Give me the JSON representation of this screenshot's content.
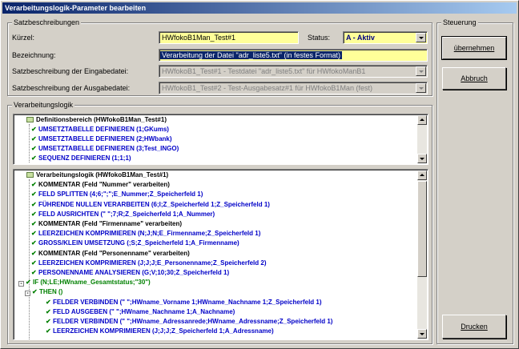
{
  "window": {
    "title": "Verarbeitungslogik-Parameter bearbeiten"
  },
  "satz": {
    "legend": "Satzbeschreibungen",
    "kuerzel_label": "Kürzel:",
    "kuerzel_value": "HWfokoB1Man_Test#1",
    "status_label": "Status:",
    "status_value": "A - Aktiv",
    "bezeichnung_label": "Bezeichnung:",
    "bezeichnung_value": "Verarbeitung der Datei \"adr_liste5.txt\" (in festes Format)",
    "eingabe_label": "Satzbeschreibung der Eingabedatei:",
    "eingabe_value": "HWfokoB1_Test#1 - Testdatei \"adr_liste5.txt\" für HWfokoManB1",
    "ausgabe_label": "Satzbeschreibung der Ausgabedatei:",
    "ausgabe_value": "HWfokoB1_Test#2 - Test-Ausgabesatz#1 für HWfokoB1Man (fest)"
  },
  "steuerung": {
    "legend": "Steuerung",
    "uebernehmen_label": "übernehmen",
    "abbruch_label": "Abbruch",
    "drucken_label": "Drucken"
  },
  "logik": {
    "legend": "Verarbeitungslogik",
    "definitions_tree": [
      {
        "text": "Definitionsbereich (HWfokoB1Man_Test#1)",
        "style": "black",
        "kind": "root"
      },
      {
        "text": "UMSETZTABELLE DEFINIEREN (1;GKums)",
        "style": "blue",
        "kind": "item"
      },
      {
        "text": "UMSETZTABELLE DEFINIEREN (2;HWbank)",
        "style": "blue",
        "kind": "item"
      },
      {
        "text": "UMSETZTABELLE DEFINIEREN (3;Test_INGO)",
        "style": "blue",
        "kind": "item"
      },
      {
        "text": "SEQUENZ DEFINIEREN (1;1;1)",
        "style": "blue",
        "kind": "item"
      }
    ],
    "logic_tree": [
      {
        "text": "Verarbeitungslogik (HWfokoB1Man_Test#1)",
        "style": "black",
        "kind": "root"
      },
      {
        "text": "KOMMENTAR (Feld \"Nummer\" verarbeiten)",
        "style": "black",
        "kind": "item"
      },
      {
        "text": "FELD SPLITTEN (4;6;\";\";E_Nummer;Z_Speicherfeld 1)",
        "style": "blue",
        "kind": "item"
      },
      {
        "text": "FÜHRENDE NULLEN VERARBEITEN (6;I;Z_Speicherfeld 1;Z_Speicherfeld 1)",
        "style": "blue",
        "kind": "item"
      },
      {
        "text": "FELD AUSRICHTEN (\" \";7;R;Z_Speicherfeld 1;A_Nummer)",
        "style": "blue",
        "kind": "item"
      },
      {
        "text": "KOMMENTAR (Feld \"Firmenname\" verarbeiten)",
        "style": "black",
        "kind": "item"
      },
      {
        "text": "LEERZEICHEN KOMPRIMIEREN (N;J;N;E_Firmenname;Z_Speicherfeld 1)",
        "style": "blue",
        "kind": "item"
      },
      {
        "text": "GROSS/KLEIN UMSETZUNG (;S;Z_Speicherfeld 1;A_Firmenname)",
        "style": "blue",
        "kind": "item"
      },
      {
        "text": "KOMMENTAR (Feld \"Personenname\" verarbeiten)",
        "style": "black",
        "kind": "item"
      },
      {
        "text": "LEERZEICHEN KOMPRIMIEREN (J;J;J;E_Personenname;Z_Speicherfeld 2)",
        "style": "blue",
        "kind": "item"
      },
      {
        "text": "PERSONENNAME ANALYSIEREN (G;V;10;30;Z_Speicherfeld 1)",
        "style": "blue",
        "kind": "item"
      },
      {
        "text": "IF (N;LE;HWname_Gesamtstatus;\"30\")",
        "style": "green",
        "kind": "if"
      },
      {
        "text": "THEN ()",
        "style": "green",
        "kind": "then"
      },
      {
        "text": "FELDER VERBINDEN (\" \";HWname_Vorname 1;HWname_Nachname 1;Z_Speicherfeld 1)",
        "style": "blue",
        "kind": "nested"
      },
      {
        "text": "FELD AUSGEBEN (\" \";HWname_Nachname 1;A_Nachname)",
        "style": "blue",
        "kind": "nested"
      },
      {
        "text": "FELDER VERBINDEN (\" \";HWname_Adressanrede;HWname_Adressname;Z_Speicherfeld 1)",
        "style": "blue",
        "kind": "nested"
      },
      {
        "text": "LEERZEICHEN KOMPRIMIEREN (J;J;J;Z_Speicherfeld 1;A_Adressname)",
        "style": "blue",
        "kind": "nested"
      }
    ]
  },
  "icons": {
    "check": "✔",
    "folder": "folder-icon"
  }
}
